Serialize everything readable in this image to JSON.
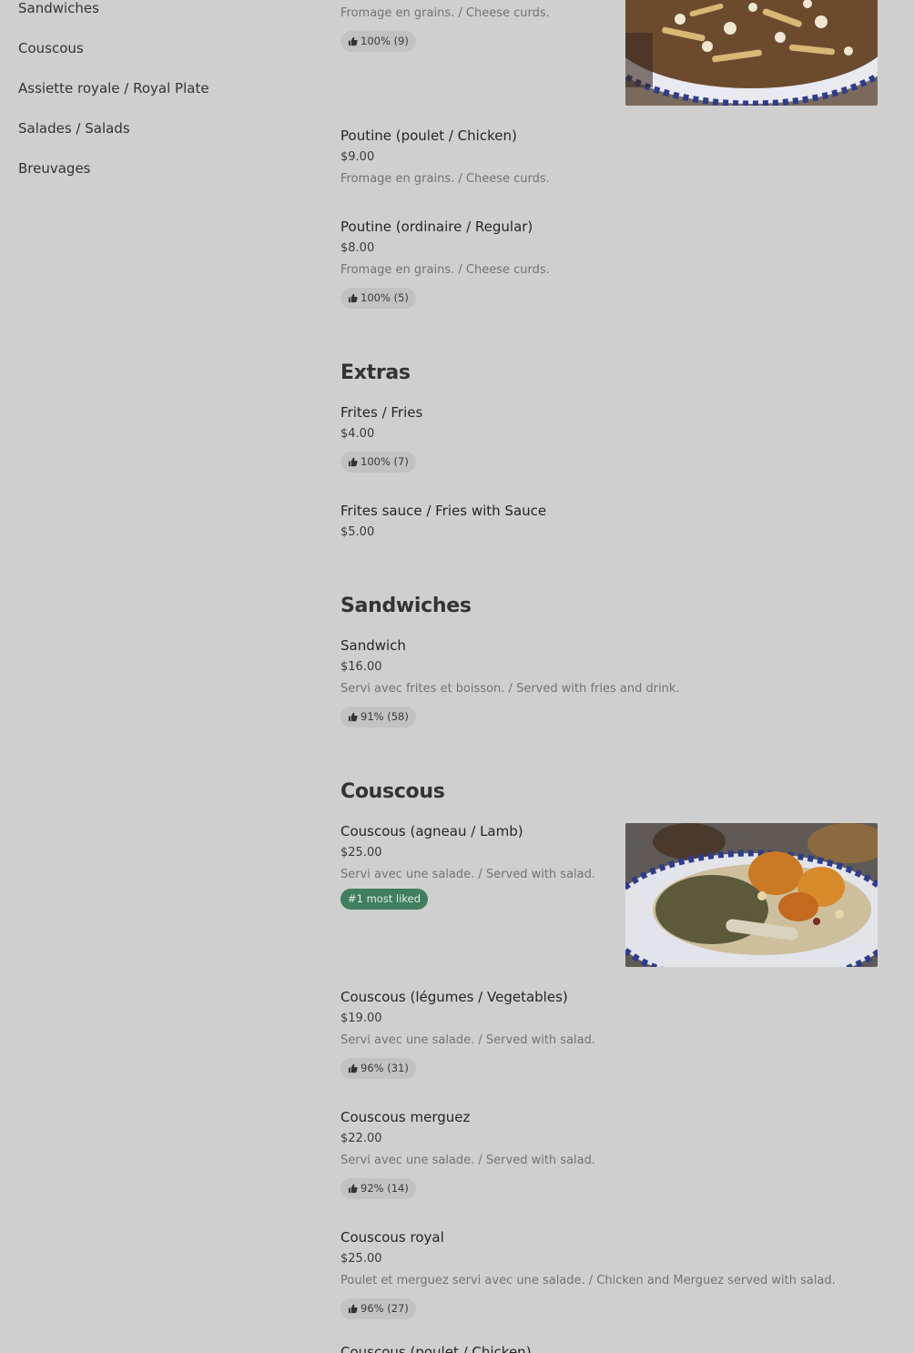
{
  "sidebar": {
    "items": [
      {
        "label": "Sandwiches"
      },
      {
        "label": "Couscous"
      },
      {
        "label": "Assiette royale / Royal Plate"
      },
      {
        "label": "Salades / Salads"
      },
      {
        "label": "Breuvages"
      }
    ]
  },
  "poutine_cont": {
    "top_desc": "Fromage en grains. / Cheese curds.",
    "top_rating": "100% (9)",
    "items": [
      {
        "name": "Poutine (poulet / Chicken)",
        "price": "$9.00",
        "desc": "Fromage en grains. / Cheese curds."
      },
      {
        "name": "Poutine (ordinaire / Regular)",
        "price": "$8.00",
        "desc": "Fromage en grains. / Cheese curds.",
        "rating": "100% (5)"
      }
    ]
  },
  "extras": {
    "title": "Extras",
    "items": [
      {
        "name": "Frites / Fries",
        "price": "$4.00",
        "rating": "100% (7)"
      },
      {
        "name": "Frites sauce / Fries with Sauce",
        "price": "$5.00"
      }
    ]
  },
  "sandwiches": {
    "title": "Sandwiches",
    "items": [
      {
        "name": "Sandwich",
        "price": "$16.00",
        "desc": "Servi avec frites et boisson. / Served with fries and drink.",
        "rating": "91% (58)"
      }
    ]
  },
  "couscous": {
    "title": "Couscous",
    "items": [
      {
        "name": "Couscous (agneau / Lamb)",
        "price": "$25.00",
        "desc": "Servi avec une salade. / Served with salad.",
        "badge": "#1 most liked"
      },
      {
        "name": "Couscous (légumes / Vegetables)",
        "price": "$19.00",
        "desc": "Servi avec une salade. / Served with salad.",
        "rating": "96% (31)"
      },
      {
        "name": "Couscous merguez",
        "price": "$22.00",
        "desc": "Servi avec une salade. / Served with salad.",
        "rating": "92% (14)"
      },
      {
        "name": "Couscous royal",
        "price": "$25.00",
        "desc": "Poulet et merguez servi avec une salade. / Chicken and Merguez served with salad.",
        "rating": "96% (27)"
      },
      {
        "name": "Couscous (poulet / Chicken)"
      }
    ]
  },
  "colors": {
    "page_bg": "#cfcfcf",
    "badge_bg": "#c2c2c2",
    "most_liked_bg": "#3f7e5e"
  },
  "icons": {
    "rating": "thumbs-up-icon"
  }
}
